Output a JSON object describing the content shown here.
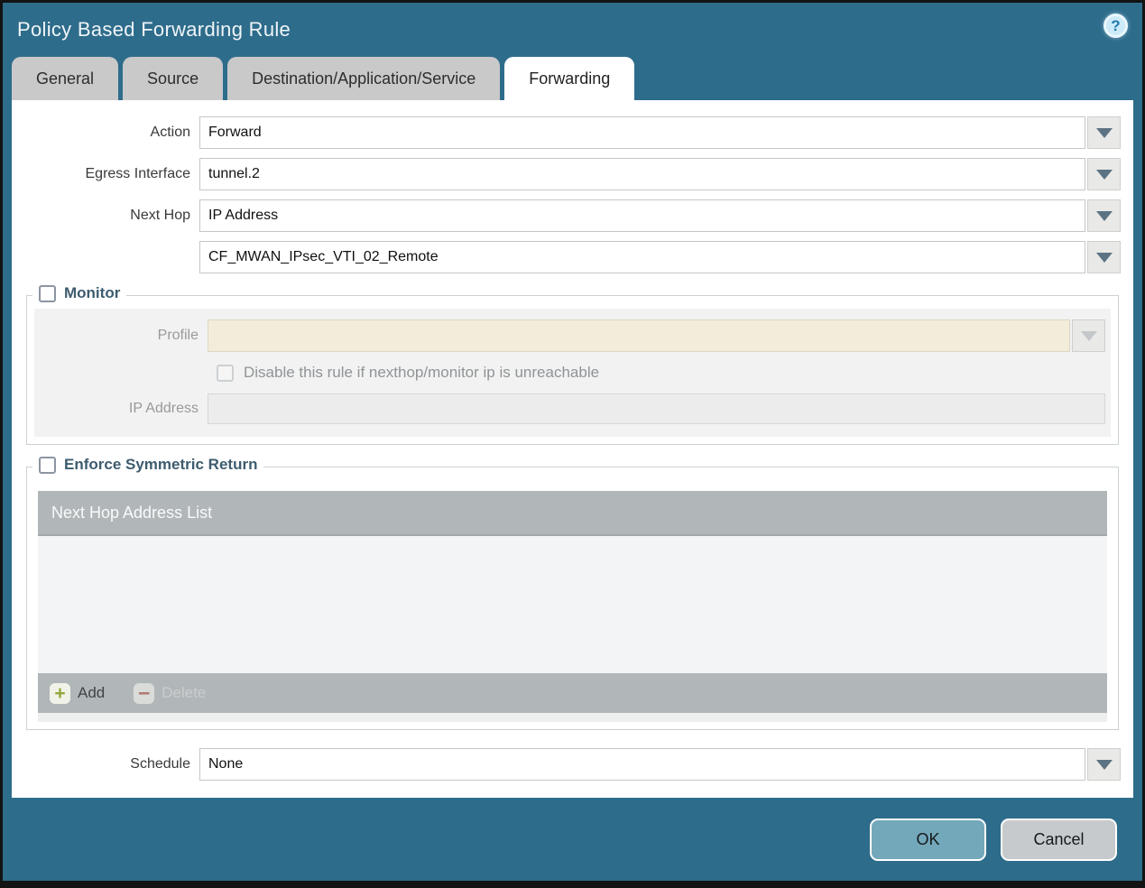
{
  "window": {
    "title": "Policy Based Forwarding Rule"
  },
  "tabs": [
    {
      "label": "General",
      "active": false
    },
    {
      "label": "Source",
      "active": false
    },
    {
      "label": "Destination/Application/Service",
      "active": false
    },
    {
      "label": "Forwarding",
      "active": true
    }
  ],
  "form": {
    "action": {
      "label": "Action",
      "value": "Forward"
    },
    "egress_interface": {
      "label": "Egress Interface",
      "value": "tunnel.2"
    },
    "next_hop": {
      "label": "Next Hop",
      "value": "IP Address"
    },
    "next_hop_address": {
      "value": "CF_MWAN_IPsec_VTI_02_Remote"
    },
    "schedule": {
      "label": "Schedule",
      "value": "None"
    }
  },
  "monitor": {
    "legend": "Monitor",
    "checked": false,
    "profile": {
      "label": "Profile",
      "value": ""
    },
    "disable_rule_checkbox": {
      "label": "Disable this rule if nexthop/monitor ip is unreachable",
      "checked": false
    },
    "ip_address": {
      "label": "IP Address",
      "value": ""
    }
  },
  "symmetric_return": {
    "legend": "Enforce Symmetric Return",
    "checked": false,
    "grid": {
      "column_header": "Next Hop Address List",
      "rows": [],
      "add_label": "Add",
      "delete_label": "Delete",
      "plus_glyph": "+",
      "minus_glyph": "−"
    }
  },
  "help": {
    "glyph": "?"
  },
  "footer": {
    "ok_label": "OK",
    "cancel_label": "Cancel"
  },
  "colors": {
    "titlebar_teal": "#2e6c8b",
    "active_tab_bg": "#ffffff",
    "inactive_tab_bg": "#c9c9c9",
    "disabled_field_beige": "#f2ecda",
    "grid_bar_gray": "#b1b6b9",
    "ok_button_blue": "#73a8bb",
    "cancel_button_gray": "#c7cacc",
    "add_icon_green": "#93a83c",
    "delete_icon_red": "#b07a73"
  }
}
